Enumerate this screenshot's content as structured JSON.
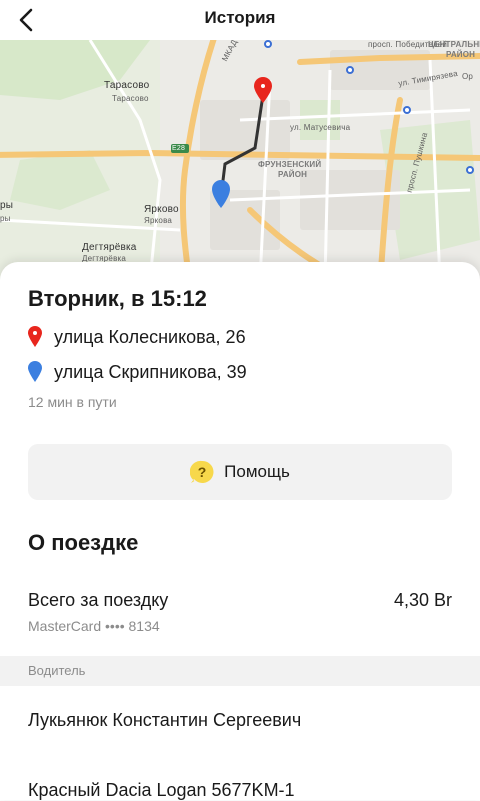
{
  "header": {
    "title": "История"
  },
  "map": {
    "labels": {
      "mkad": "МКАД",
      "pobediteley": "просп. Победителей",
      "central": "ЦЕНТРАЛЬНЫЙ",
      "raion_short": "РАЙОН",
      "timiryazeva": "ул. Тимирязева",
      "or": "Ор",
      "tarasovo_1": "Тарасово",
      "tarasovo_2": "Тарасово",
      "matusevicha": "ул. Матусевича",
      "pushkina": "просп. Пушкина",
      "e28": "E28",
      "frunzenskiy": "ФРУНЗЕНСКИЙ",
      "frunzenskiy_raion": "РАЙОН",
      "ry_1": "ры",
      "ry_2": "ры",
      "yarkovo_1": "Ярково",
      "yarkovo_2": "Яркова",
      "degtyarevka_1": "Дегтярёвка",
      "degtyarevka_2": "Дегтярёвка"
    }
  },
  "trip": {
    "date": "Вторник, в 15:12",
    "from": "улица Колесникова, 26",
    "to": "улица Скрипникова, 39",
    "duration": "12 мин в пути"
  },
  "help": {
    "label": "Помощь"
  },
  "about": {
    "title": "О поездке",
    "total_label": "Всего за поездку",
    "total_value": "4,30 Br",
    "payment": "MasterCard •••• 8134"
  },
  "driver_section": {
    "label": "Водитель",
    "name": "Лукьянюк Константин Сергеевич",
    "car": "Красный Dacia Logan 5677KM-1"
  },
  "colors": {
    "pin_start": "#e8261d",
    "pin_end": "#3b7fe0",
    "help_icon": "#f7d84b",
    "route": "#333333"
  }
}
